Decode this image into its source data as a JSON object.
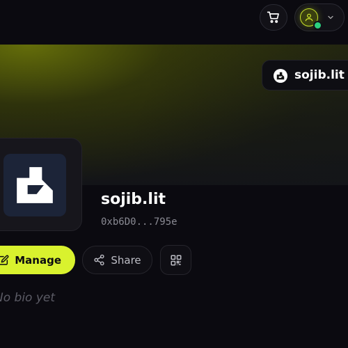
{
  "header": {
    "cart_icon": "cart-icon",
    "account_icon": "user-icon",
    "status": "online",
    "status_color": "#2bd07f"
  },
  "banner": {
    "name_chip": "sojib.lit"
  },
  "profile": {
    "name": "sojib.lit",
    "address": "0xb6D0...795e",
    "bio": "No bio yet"
  },
  "actions": {
    "manage_label": "Manage",
    "share_label": "Share"
  },
  "colors": {
    "accent": "#d9f22e",
    "background": "#0b0a10",
    "logo_bg": "#1c2438"
  }
}
